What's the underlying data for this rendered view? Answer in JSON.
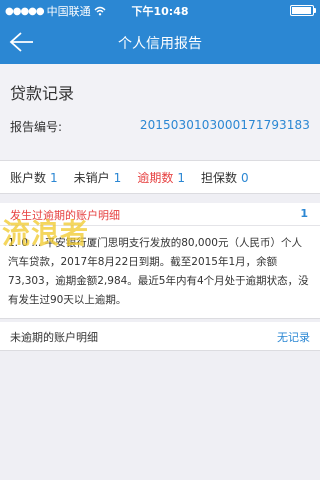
{
  "status_bar": {
    "carrier": "中国联通",
    "time": "下午10:48",
    "icons": [
      "signal-dots-icon",
      "wifi-icon",
      "battery-icon"
    ]
  },
  "nav": {
    "title": "个人信用报告",
    "back_icon": "back-arrow-icon"
  },
  "loan_section": {
    "title": "贷款记录",
    "report_label": "报告编号:",
    "report_number": "2015030103000171793183"
  },
  "counts": [
    {
      "label": "账户数",
      "value": "1"
    },
    {
      "label": "未销户",
      "value": "1"
    },
    {
      "label": "逾期数",
      "value": "1"
    },
    {
      "label": "担保数",
      "value": "0"
    }
  ],
  "overdue": {
    "title": "发生过逾期的账户明细",
    "count": "1",
    "detail": "1. 0 ... 平安银行厦门思明支行发放的80,000元（人民币）个人汽车贷款，2017年8月22日到期。截至2015年1月，余额73,303，逾期金额2,984。最近5年内有4个月处于逾期状态，没有发生过90天以上逾期。",
    "watermark": "流浪者"
  },
  "not_overdue": {
    "title": "未逾期的账户明细",
    "link": "无记录"
  },
  "colors": {
    "primary": "#2b87d3",
    "alert": "#e64040",
    "background": "#efeff4"
  }
}
